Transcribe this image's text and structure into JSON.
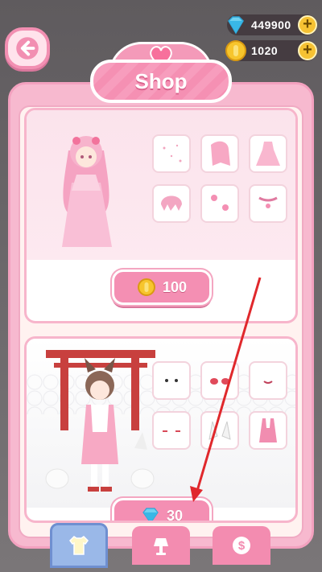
{
  "header": {
    "title": "Shop",
    "gems": "449900",
    "coins": "1020"
  },
  "icons": {
    "back": "arrow-left-icon",
    "gem": "diamond-icon",
    "coin": "coin-icon",
    "plus": "plus-icon",
    "heart": "heart-icon"
  },
  "items": [
    {
      "name": "sakura-princess-outfit",
      "price": "100",
      "currency": "coin"
    },
    {
      "name": "fox-shrine-maiden-outfit",
      "price": "30",
      "currency": "gem"
    }
  ],
  "tabs": [
    {
      "name": "clothes",
      "icon": "shirt-icon",
      "selected": true
    },
    {
      "name": "furniture",
      "icon": "lamp-icon",
      "selected": false
    },
    {
      "name": "coins",
      "icon": "dollar-coin-icon",
      "selected": false
    }
  ],
  "colors": {
    "accent": "#f48fb3",
    "annotation": "#e0282c"
  },
  "plus_label": "+"
}
